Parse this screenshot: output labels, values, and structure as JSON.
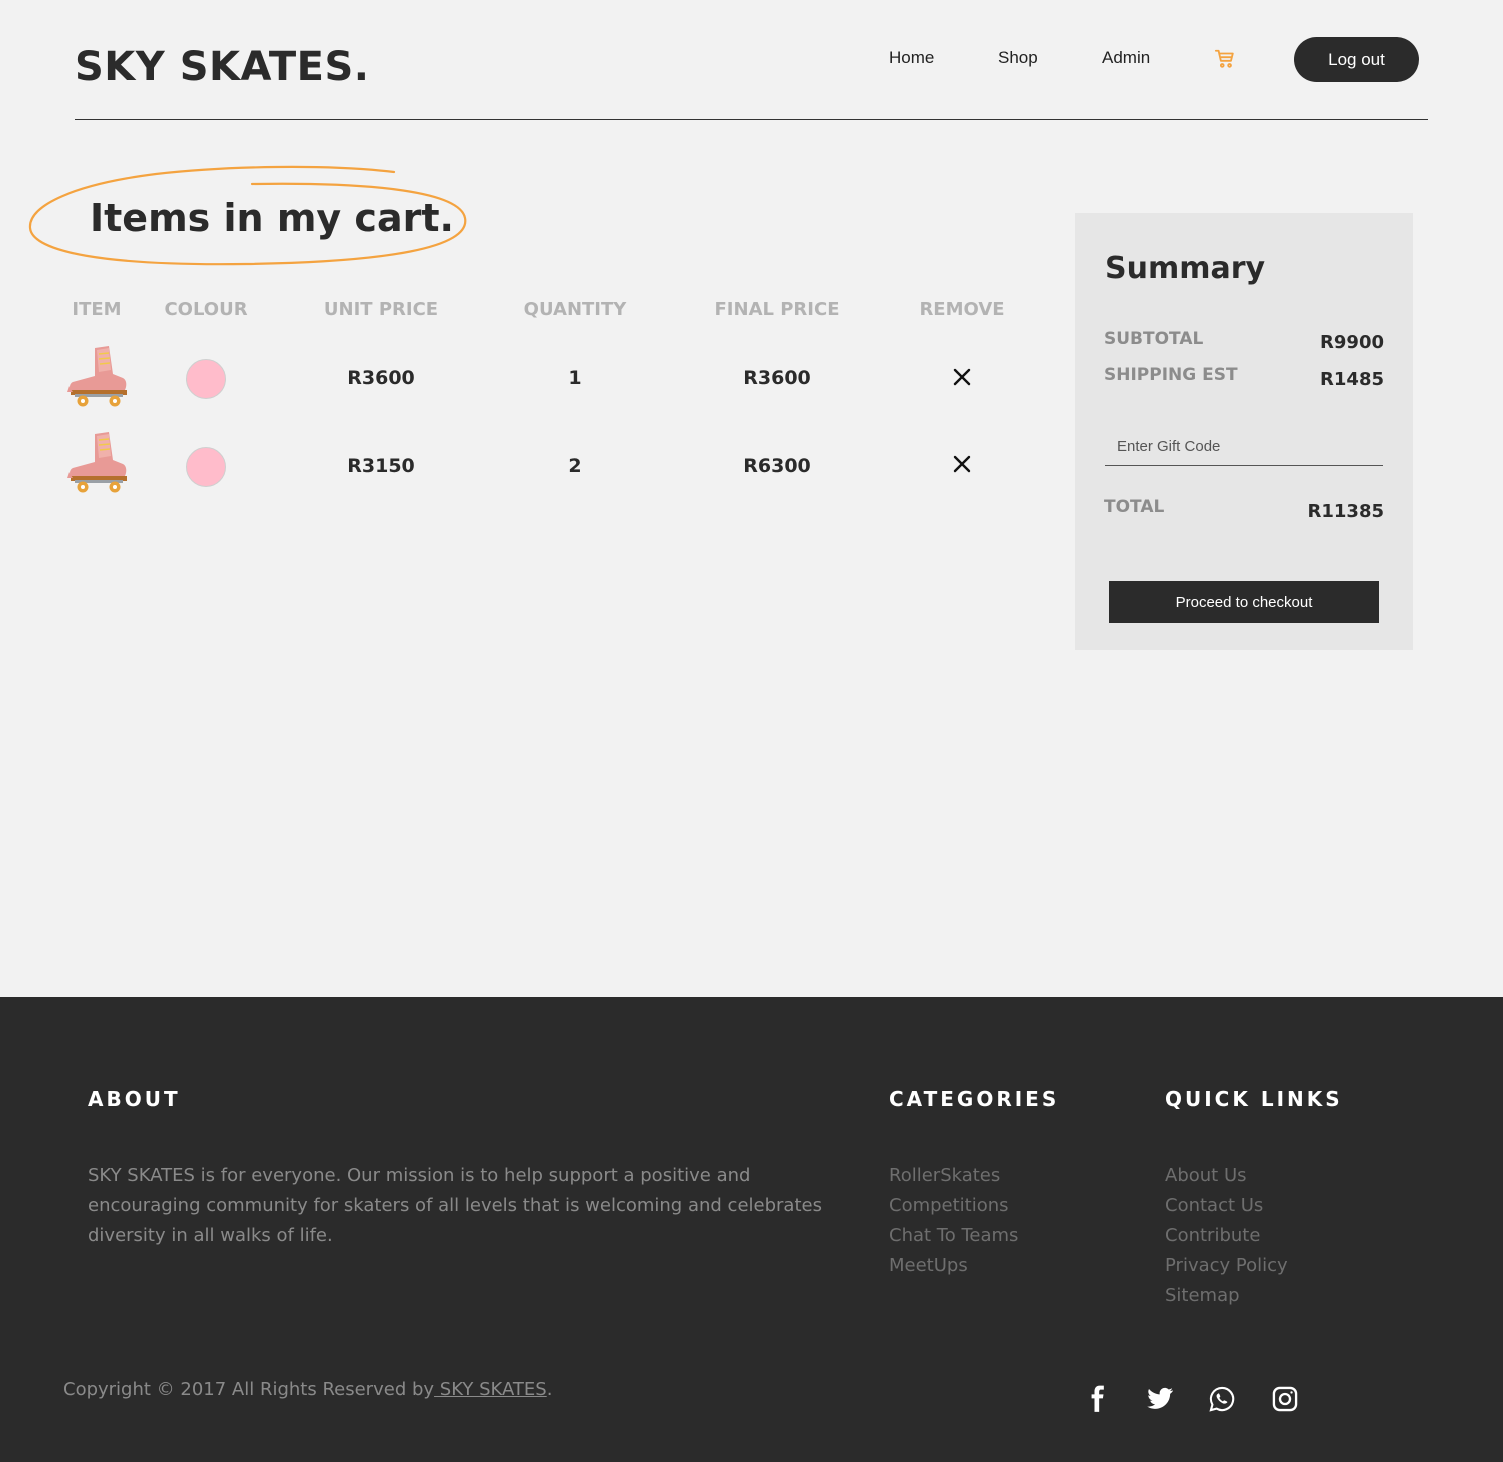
{
  "header": {
    "brand": "SKY SKATES.",
    "nav": [
      "Home",
      "Shop",
      "Admin"
    ],
    "logout_label": "Log out"
  },
  "cart": {
    "title": "Items in my cart.",
    "columns": [
      "ITEM",
      "COLOUR",
      "UNIT PRICE",
      "QUANTITY",
      "FINAL PRICE",
      "REMOVE"
    ],
    "rows": [
      {
        "colour": "#ffbccb",
        "unit_price": "R3600",
        "quantity": "1",
        "final_price": "R3600"
      },
      {
        "colour": "#ffbccb",
        "unit_price": "R3150",
        "quantity": "2",
        "final_price": "R6300"
      }
    ]
  },
  "summary": {
    "title": "Summary",
    "subtotal_label": "SUBTOTAL",
    "subtotal": "R9900",
    "shipping_label": "SHIPPING EST",
    "shipping": "R1485",
    "gift_placeholder": "Enter Gift Code",
    "total_label": "TOTAL",
    "total": "R11385",
    "checkout_label": "Proceed to checkout"
  },
  "footer": {
    "about_heading": "ABOUT",
    "about_text": "SKY SKATES is for everyone. Our mission is to help support a positive and encouraging community for skaters of all levels that is welcoming and celebrates diversity in all walks of life.",
    "categories_heading": "CATEGORIES",
    "categories": [
      "RollerSkates",
      "Competitions",
      "Chat To Teams",
      "MeetUps"
    ],
    "quicklinks_heading": "QUICK LINKS",
    "quicklinks": [
      "About Us",
      "Contact Us",
      "Contribute",
      "Privacy Policy",
      "Sitemap"
    ],
    "copyright_prefix": "Copyright © 2017 All Rights Reserved by",
    "copyright_link": " SKY SKATES",
    "copyright_suffix": "."
  },
  "colors": {
    "accent": "#f4a340",
    "dark": "#2b2b2b",
    "background": "#f2f2f2"
  }
}
